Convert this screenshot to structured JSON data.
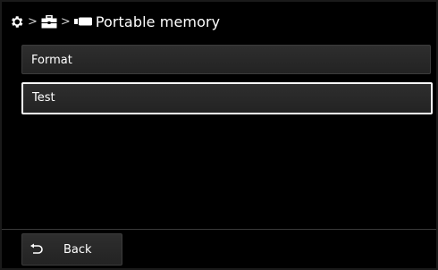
{
  "header": {
    "separator": ">",
    "title": "Portable memory",
    "icons": [
      "gear-icon",
      "toolbox-icon",
      "memory-stick-icon"
    ]
  },
  "menu": {
    "items": [
      {
        "label": "Format",
        "selected": false
      },
      {
        "label": "Test",
        "selected": true
      }
    ]
  },
  "footer": {
    "back_label": "Back",
    "back_icon": "return-arrow-icon"
  },
  "colors": {
    "background": "#000000",
    "text": "#ffffff",
    "button": "#2a2a2a",
    "selection_border": "#ffffff"
  }
}
